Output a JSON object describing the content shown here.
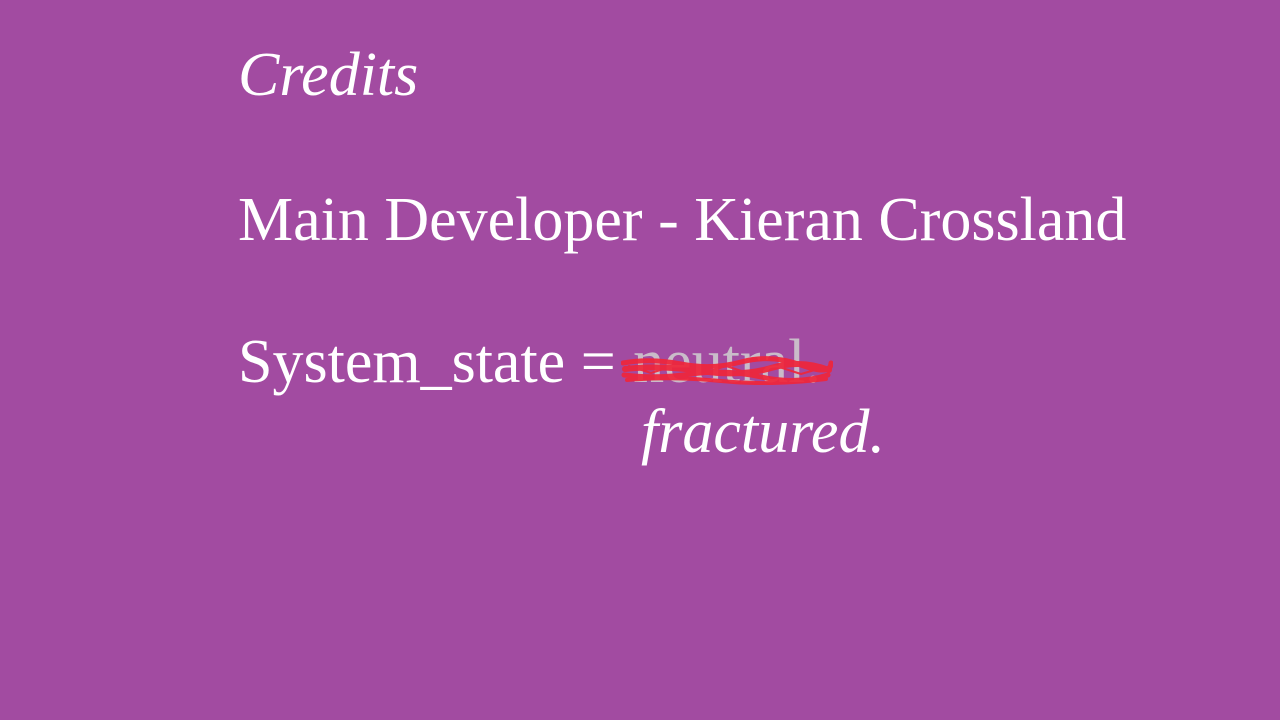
{
  "credits": {
    "title": "Credits",
    "role": "Main Developer",
    "separator": "-",
    "name": "Kieran Crossland"
  },
  "system_state": {
    "label": "System_state =",
    "old_value": "neutral.",
    "new_value": "fractured."
  },
  "colors": {
    "background": "#a24ba1",
    "text": "#ffffff",
    "struck_text": "#c9bcc9",
    "scribble": "#f0263a"
  }
}
